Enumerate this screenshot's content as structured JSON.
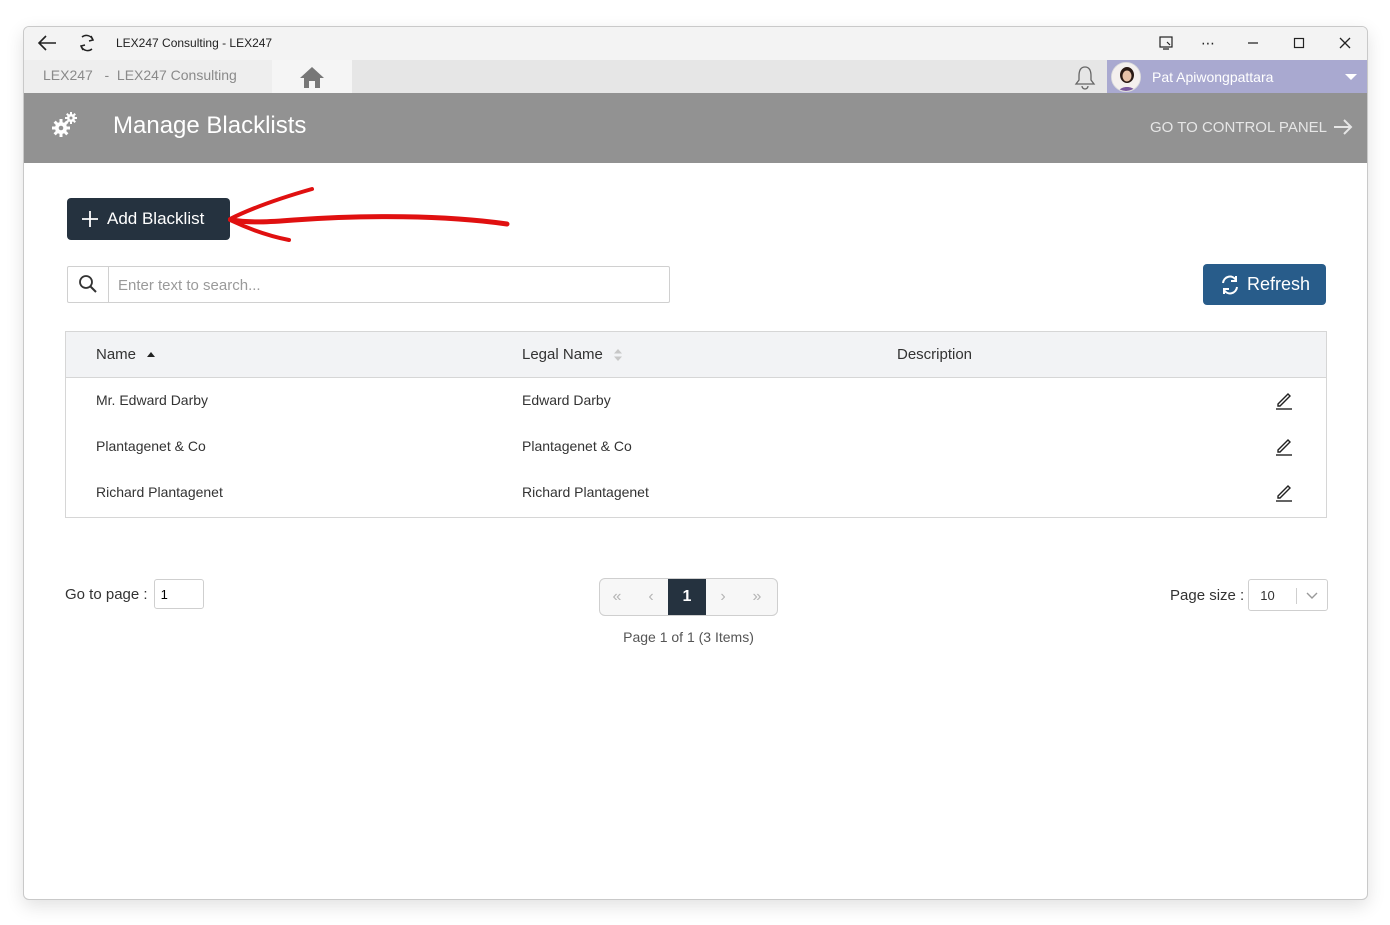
{
  "window": {
    "title": "LEX247 Consulting - LEX247"
  },
  "appnav": {
    "breadcrumb": "LEX247   -  LEX247 Consulting",
    "user_name": "Pat Apiwongpattara"
  },
  "header": {
    "title": "Manage Blacklists",
    "control_panel_label": "GO TO CONTROL PANEL"
  },
  "toolbar": {
    "add_label": "Add Blacklist",
    "refresh_label": "Refresh",
    "search_placeholder": "Enter text to search..."
  },
  "table": {
    "columns": [
      "Name",
      "Legal Name",
      "Description"
    ],
    "sort": {
      "column": "Name",
      "direction": "ascending"
    },
    "rows": [
      {
        "name": "Mr. Edward Darby",
        "legal_name": "Edward Darby",
        "description": ""
      },
      {
        "name": "Plantagenet & Co",
        "legal_name": "Plantagenet & Co",
        "description": ""
      },
      {
        "name": "Richard Plantagenet",
        "legal_name": "Richard Plantagenet",
        "description": ""
      }
    ]
  },
  "pager": {
    "goto_label": "Go to page :",
    "goto_value": "1",
    "current_page": "1",
    "info": "Page 1 of 1 (3 Items)",
    "page_size_label": "Page size :",
    "page_size_value": "10"
  },
  "colors": {
    "dark_button": "#25323f",
    "refresh_button": "#285c8a",
    "header_bg": "#929292",
    "user_bar": "#a9a9d0",
    "annotation_arrow": "#e01010"
  },
  "icons": {
    "back": "arrow-left-icon",
    "reload": "reload-icon",
    "home": "home-icon",
    "bell": "bell-icon",
    "gear": "gears-icon",
    "arrow_right": "arrow-right-icon",
    "plus": "plus-icon",
    "search": "search-icon",
    "refresh": "refresh-icon",
    "edit": "pencil-icon"
  }
}
